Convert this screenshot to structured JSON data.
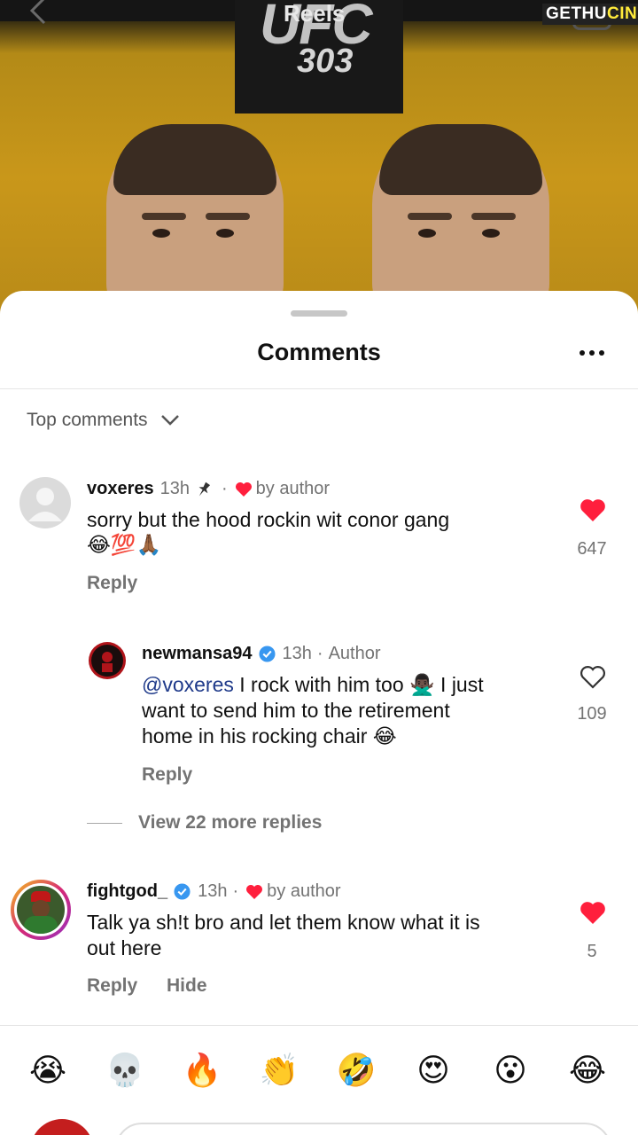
{
  "reel": {
    "title": "Reels",
    "event_brand": "UFC",
    "event_number": "303",
    "watermark_part1": "GETHU",
    "watermark_part2": "CINEMA"
  },
  "sheet": {
    "title": "Comments",
    "sort_label": "Top comments"
  },
  "comments": [
    {
      "username": "voxeres",
      "time": "13h",
      "by_author": "by author",
      "text": "sorry but the hood rockin wit conor gang",
      "emojis": "😂💯🙏🏾",
      "likes": "647",
      "reply_label": "Reply",
      "liked": true
    },
    {
      "username": "newmansa94",
      "time": "13h",
      "badge": "Author",
      "mention": "@voxeres",
      "text_line1": " I rock with him too 🙅🏿‍♂️ I just",
      "text_line2": "want to send him to the retirement",
      "text_line3": "home in his rocking chair 😂",
      "likes": "109",
      "reply_label": "Reply",
      "liked": false
    },
    {
      "username": "fightgod_",
      "time": "13h",
      "by_author": "by author",
      "text_line1": "Talk ya sh!t bro and let them know what it is",
      "text_line2": "out here",
      "likes": "5",
      "reply_label": "Reply",
      "hide_label": "Hide",
      "liked": true
    }
  ],
  "view_more": "View 22 more replies",
  "emoji_bar": [
    "😭",
    "💀",
    "🔥",
    "👏",
    "🤣",
    "😍",
    "😮",
    "😂"
  ],
  "colors": {
    "heart": "#ff1f3d",
    "verified": "#3897f0",
    "reel_bg": "#c9971a"
  }
}
